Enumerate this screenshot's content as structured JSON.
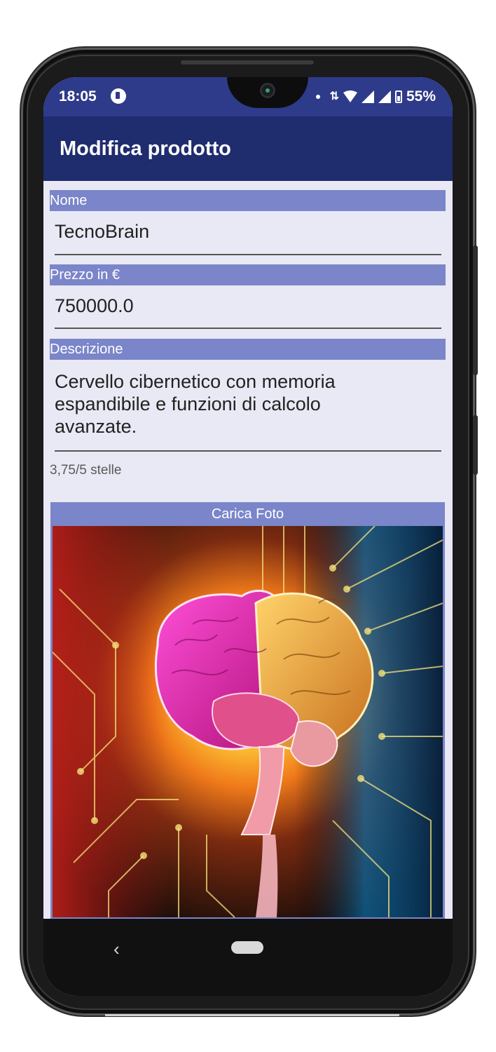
{
  "status_bar": {
    "time": "18:05",
    "battery": "55%",
    "icons": [
      "app-notification-icon",
      "dot-icon",
      "data-arrows-icon",
      "wifi-icon",
      "signal-icon",
      "signal-icon",
      "battery-icon"
    ]
  },
  "app_bar": {
    "title": "Modifica prodotto"
  },
  "form": {
    "name_label": "Nome",
    "name_value": "TecnoBrain",
    "price_label": "Prezzo in €",
    "price_value": "750000.0",
    "description_label": "Descrizione",
    "description_value": "Cervello cibernetico con memoria espandibile e funzioni di calcolo avanzate.",
    "description_lines": [
      "Cervello cibernetico con memoria",
      "espandibile e funzioni di calcolo",
      "avanzate."
    ],
    "rating_text": "3,75/5 stelle",
    "rating_value": 3.75
  },
  "photo": {
    "upload_label": "Carica Foto",
    "subject": "brain-circuit-image"
  },
  "nav_bar": {
    "icons": [
      "back-icon",
      "home-icon"
    ]
  },
  "colors": {
    "status_bar": "#2e3b8a",
    "app_bar": "#1f2c6e",
    "label_band": "#7b85c9",
    "background": "#e8e9f4"
  }
}
